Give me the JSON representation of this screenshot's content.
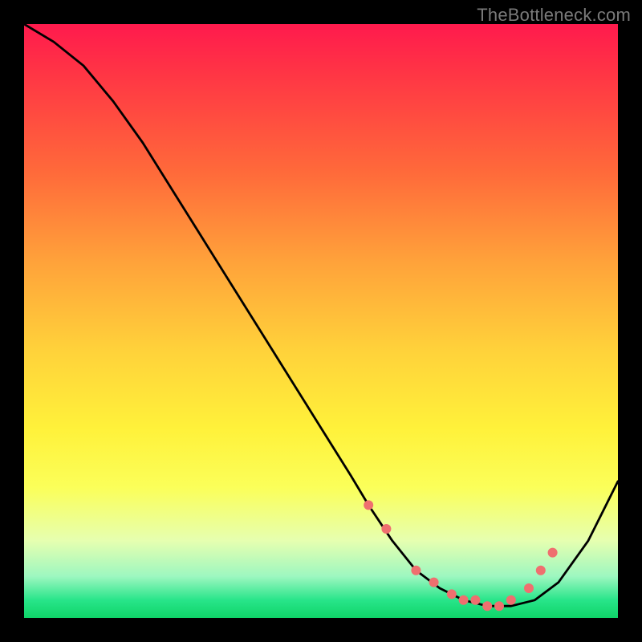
{
  "watermark": "TheBottleneck.com",
  "chart_data": {
    "type": "line",
    "title": "",
    "xlabel": "",
    "ylabel": "",
    "xlim": [
      0,
      100
    ],
    "ylim": [
      0,
      100
    ],
    "grid": false,
    "legend": false,
    "series": [
      {
        "name": "bottleneck-curve",
        "x": [
          0,
          5,
          10,
          15,
          20,
          25,
          30,
          35,
          40,
          45,
          50,
          55,
          58,
          62,
          66,
          70,
          74,
          78,
          82,
          86,
          90,
          95,
          100
        ],
        "y": [
          100,
          97,
          93,
          87,
          80,
          72,
          64,
          56,
          48,
          40,
          32,
          24,
          19,
          13,
          8,
          5,
          3,
          2,
          2,
          3,
          6,
          13,
          23
        ]
      }
    ],
    "markers": {
      "name": "highlight-points",
      "color": "#ef6f6f",
      "x": [
        58,
        61,
        66,
        69,
        72,
        74,
        76,
        78,
        80,
        82,
        85,
        87,
        89
      ],
      "y": [
        19,
        15,
        8,
        6,
        4,
        3,
        3,
        2,
        2,
        3,
        5,
        8,
        11
      ]
    },
    "gradient_stops": [
      {
        "pos": 0.0,
        "color": "#ff1a4d"
      },
      {
        "pos": 0.25,
        "color": "#ff6a3a"
      },
      {
        "pos": 0.55,
        "color": "#ffd23a"
      },
      {
        "pos": 0.78,
        "color": "#fbff59"
      },
      {
        "pos": 0.93,
        "color": "#9df7c0"
      },
      {
        "pos": 1.0,
        "color": "#0fd468"
      }
    ]
  }
}
